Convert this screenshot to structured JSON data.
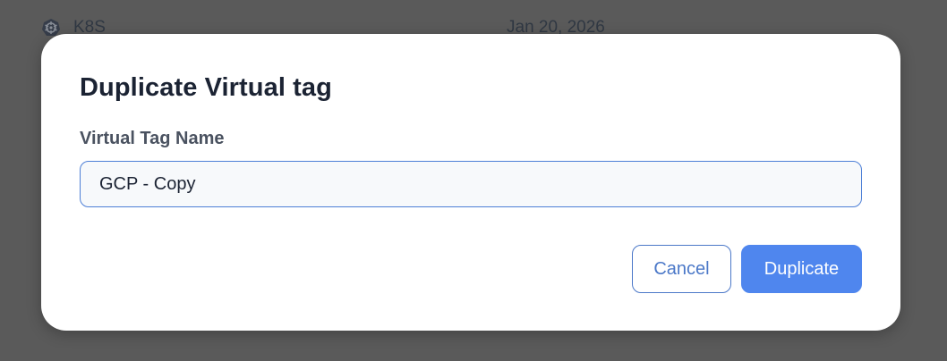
{
  "background": {
    "row": {
      "icon": "kubernetes-icon",
      "name": "K8S",
      "date": "Jan 20, 2026"
    }
  },
  "modal": {
    "title": "Duplicate Virtual tag",
    "field": {
      "label": "Virtual Tag Name",
      "value": "GCP - Copy"
    },
    "buttons": {
      "cancel_label": "Cancel",
      "duplicate_label": "Duplicate"
    }
  },
  "colors": {
    "overlay": "#5a5a5a",
    "primary": "#4f86ee",
    "outline": "#4b78c8",
    "title_text": "#1b2333"
  }
}
